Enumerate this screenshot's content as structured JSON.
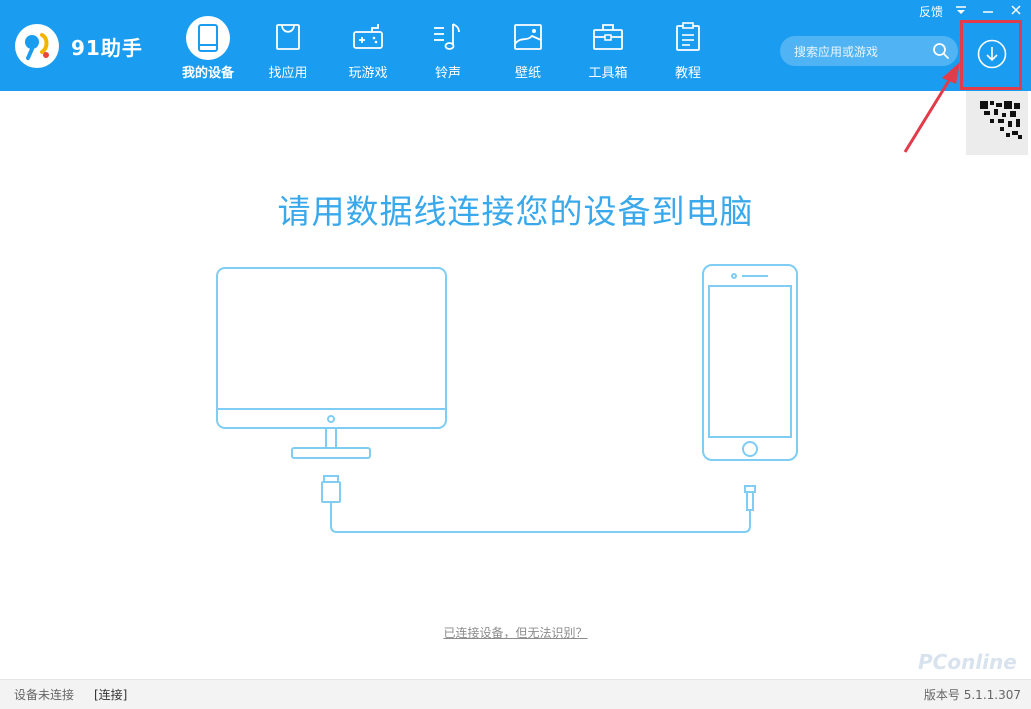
{
  "app": {
    "name": "91助手"
  },
  "nav": {
    "items": [
      {
        "label": "我的设备",
        "icon": "tablet-icon",
        "active": true
      },
      {
        "label": "找应用",
        "icon": "shopping-bag-icon"
      },
      {
        "label": "玩游戏",
        "icon": "gamepad-icon"
      },
      {
        "label": "铃声",
        "icon": "music-note-icon"
      },
      {
        "label": "壁纸",
        "icon": "picture-icon"
      },
      {
        "label": "工具箱",
        "icon": "toolbox-icon"
      },
      {
        "label": "教程",
        "icon": "clipboard-icon"
      }
    ]
  },
  "search": {
    "placeholder": "搜索应用或游戏"
  },
  "titlebar": {
    "feedback_label": "反馈"
  },
  "main": {
    "headline": "请用数据线连接您的设备到电脑",
    "help_link": "已连接设备，但无法识别？"
  },
  "status": {
    "device_state": "设备未连接",
    "connect_label": "[连接]",
    "version": "版本号 5.1.1.307"
  },
  "watermark": "PConline",
  "colors": {
    "topbar": "#1a9cf0",
    "headline": "#3aa9ec",
    "illustration_stroke": "#7fcdf3",
    "highlight": "#e23b4a"
  }
}
